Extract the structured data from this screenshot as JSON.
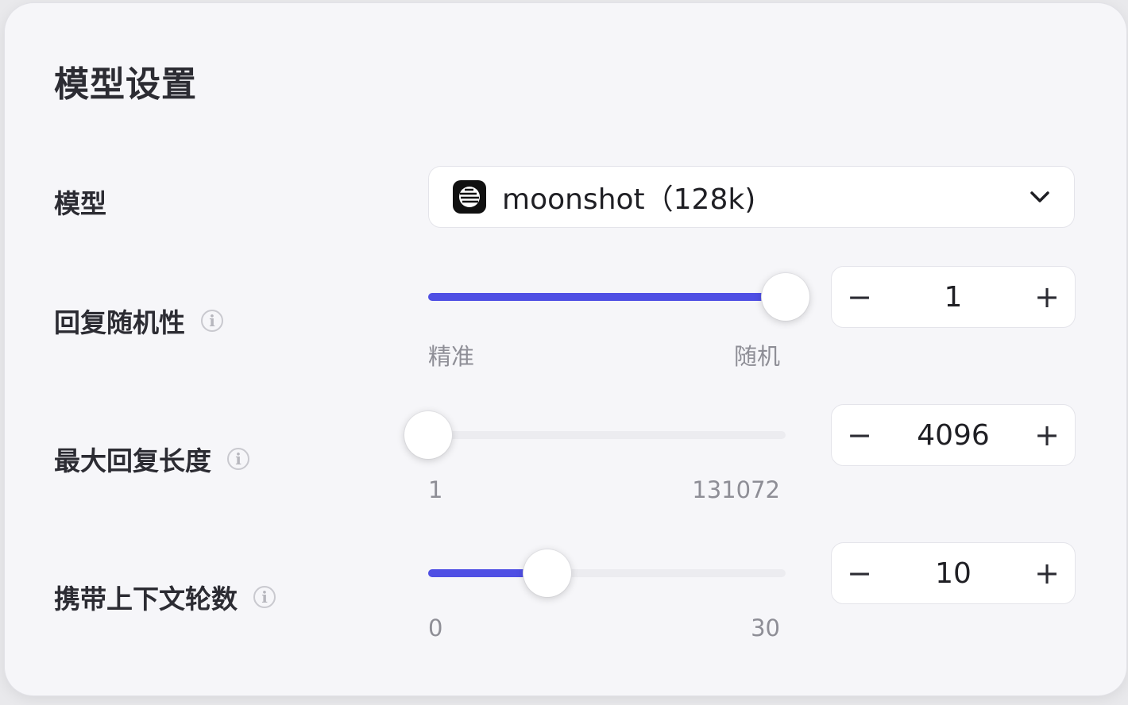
{
  "title": "模型设置",
  "model": {
    "label": "模型",
    "selected": "moonshot（128k)",
    "logo_icon": "moonshot-logo-icon",
    "dropdown_icon": "chevron-down-icon"
  },
  "randomness": {
    "label": "回复随机性",
    "min_label": "精准",
    "max_label": "随机",
    "value": "1",
    "slider_fraction": 1.0,
    "decrement": "−",
    "increment": "+"
  },
  "max_length": {
    "label": "最大回复长度",
    "min_label": "1",
    "max_label": "131072",
    "value": "4096",
    "slider_fraction": 0.0,
    "decrement": "−",
    "increment": "+"
  },
  "context_rounds": {
    "label": "携带上下文轮数",
    "min_label": "0",
    "max_label": "30",
    "value": "10",
    "slider_fraction": 0.333,
    "decrement": "−",
    "increment": "+"
  },
  "info_icon_glyph": "i",
  "colors": {
    "accent": "#4f4fe4",
    "panel_bg": "#f6f6f9"
  }
}
